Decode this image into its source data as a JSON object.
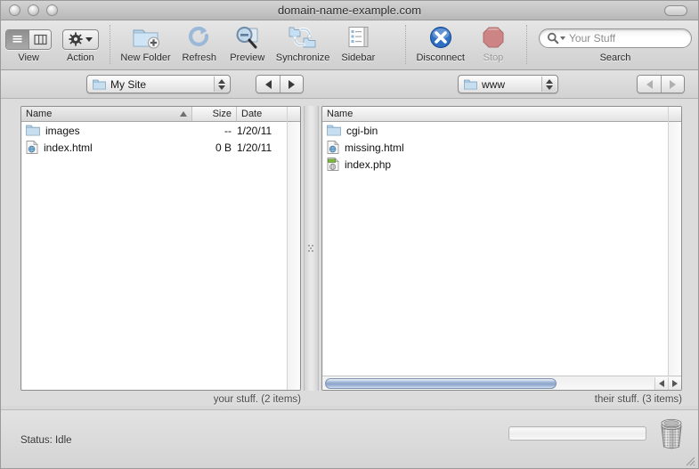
{
  "window": {
    "title": "domain-name-example.com",
    "traffic_lights": [
      "close",
      "minimize",
      "zoom"
    ],
    "toolbar_toggle": "toolbar-toggle"
  },
  "toolbar": {
    "items": [
      {
        "id": "view",
        "label": "View",
        "icon": "view-segmented-icon",
        "enabled": true
      },
      {
        "id": "action",
        "label": "Action",
        "icon": "gear-icon",
        "enabled": true
      },
      {
        "id": "new-folder",
        "label": "New Folder",
        "icon": "new-folder-icon",
        "enabled": true
      },
      {
        "id": "refresh",
        "label": "Refresh",
        "icon": "refresh-icon",
        "enabled": true
      },
      {
        "id": "preview",
        "label": "Preview",
        "icon": "preview-icon",
        "enabled": true
      },
      {
        "id": "synchronize",
        "label": "Synchronize",
        "icon": "synchronize-icon",
        "enabled": true
      },
      {
        "id": "sidebar",
        "label": "Sidebar",
        "icon": "sidebar-icon",
        "enabled": true
      },
      {
        "id": "disconnect",
        "label": "Disconnect",
        "icon": "disconnect-icon",
        "enabled": true
      },
      {
        "id": "stop",
        "label": "Stop",
        "icon": "stop-icon",
        "enabled": false
      }
    ],
    "search": {
      "label": "Search",
      "placeholder": "Your Stuff",
      "value": "",
      "icon": "search-icon"
    }
  },
  "pathbar": {
    "left": {
      "popup_label": "My Site",
      "popup_icon": "folder-icon",
      "back_enabled": true,
      "forward_enabled": true
    },
    "right": {
      "popup_label": "www",
      "popup_icon": "folder-icon",
      "back_enabled": false,
      "forward_enabled": false
    }
  },
  "panes": {
    "left": {
      "columns": [
        {
          "key": "name",
          "label": "Name",
          "sorted": true,
          "sort_dir": "asc"
        },
        {
          "key": "size",
          "label": "Size",
          "sorted": false
        },
        {
          "key": "date",
          "label": "Date",
          "sorted": false
        }
      ],
      "rows": [
        {
          "name": "images",
          "icon": "folder-icon",
          "size": "--",
          "date": "1/20/11"
        },
        {
          "name": "index.html",
          "icon": "html-file-icon",
          "size": "0 B",
          "date": "1/20/11"
        }
      ],
      "caption": "your stuff. (2 items)"
    },
    "right": {
      "columns": [
        {
          "key": "name",
          "label": "Name",
          "sorted": false
        }
      ],
      "rows": [
        {
          "name": "cgi-bin",
          "icon": "folder-icon"
        },
        {
          "name": "missing.html",
          "icon": "html-file-icon"
        },
        {
          "name": "index.php",
          "icon": "php-file-icon"
        }
      ],
      "caption": "their stuff. (3 items)",
      "hscroll_icon": "horizontal-scrollbar"
    }
  },
  "status": {
    "text": "Status: Idle",
    "progress_percent": 0,
    "trash_icon": "trash-can-icon"
  },
  "colors": {
    "window_bg": "#dcdcdc",
    "toolbar_top": "#e6e6e6",
    "toolbar_bottom": "#cfcfcf",
    "list_bg": "#ffffff",
    "scrollbar_blue": "#8ba6cc",
    "folder_blue": "#a8c8e4",
    "disconnect_blue": "#2e6fc4",
    "stop_red": "#c97b7b"
  }
}
